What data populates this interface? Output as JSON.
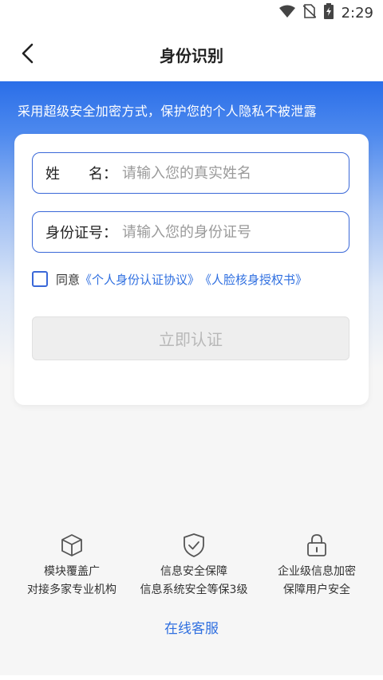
{
  "status_bar": {
    "time": "2:29",
    "icons": [
      "wifi-icon",
      "no-sim-icon",
      "battery-charging-icon"
    ]
  },
  "header": {
    "title": "身份识别",
    "back_icon": "back-arrow-icon"
  },
  "hero": {
    "text": "采用超级安全加密方式，保护您的个人隐私不被泄露"
  },
  "form": {
    "name": {
      "label": "姓　　名：",
      "placeholder": "请输入您的真实姓名",
      "value": ""
    },
    "id_number": {
      "label": "身份证号：",
      "placeholder": "请输入您的身份证号",
      "value": ""
    },
    "agreement": {
      "checked": false,
      "prefix": "同意",
      "link1": "《个人身份认证协议》",
      "link2": "《人脸核身授权书》"
    },
    "submit_label": "立即认证"
  },
  "features": [
    {
      "icon": "cube-icon",
      "line1": "模块覆盖广",
      "line2": "对接多家专业机构"
    },
    {
      "icon": "shield-check-icon",
      "line1": "信息安全保障",
      "line2": "信息系统安全等保3级"
    },
    {
      "icon": "lock-icon",
      "line1": "企业级信息加密",
      "line2": "保障用户安全"
    }
  ],
  "service_link": "在线客服",
  "colors": {
    "accent": "#2f6fe0",
    "hero_top": "#2a6ee8",
    "border": "#3a68d8",
    "disabled_text": "#b8b8b8"
  }
}
